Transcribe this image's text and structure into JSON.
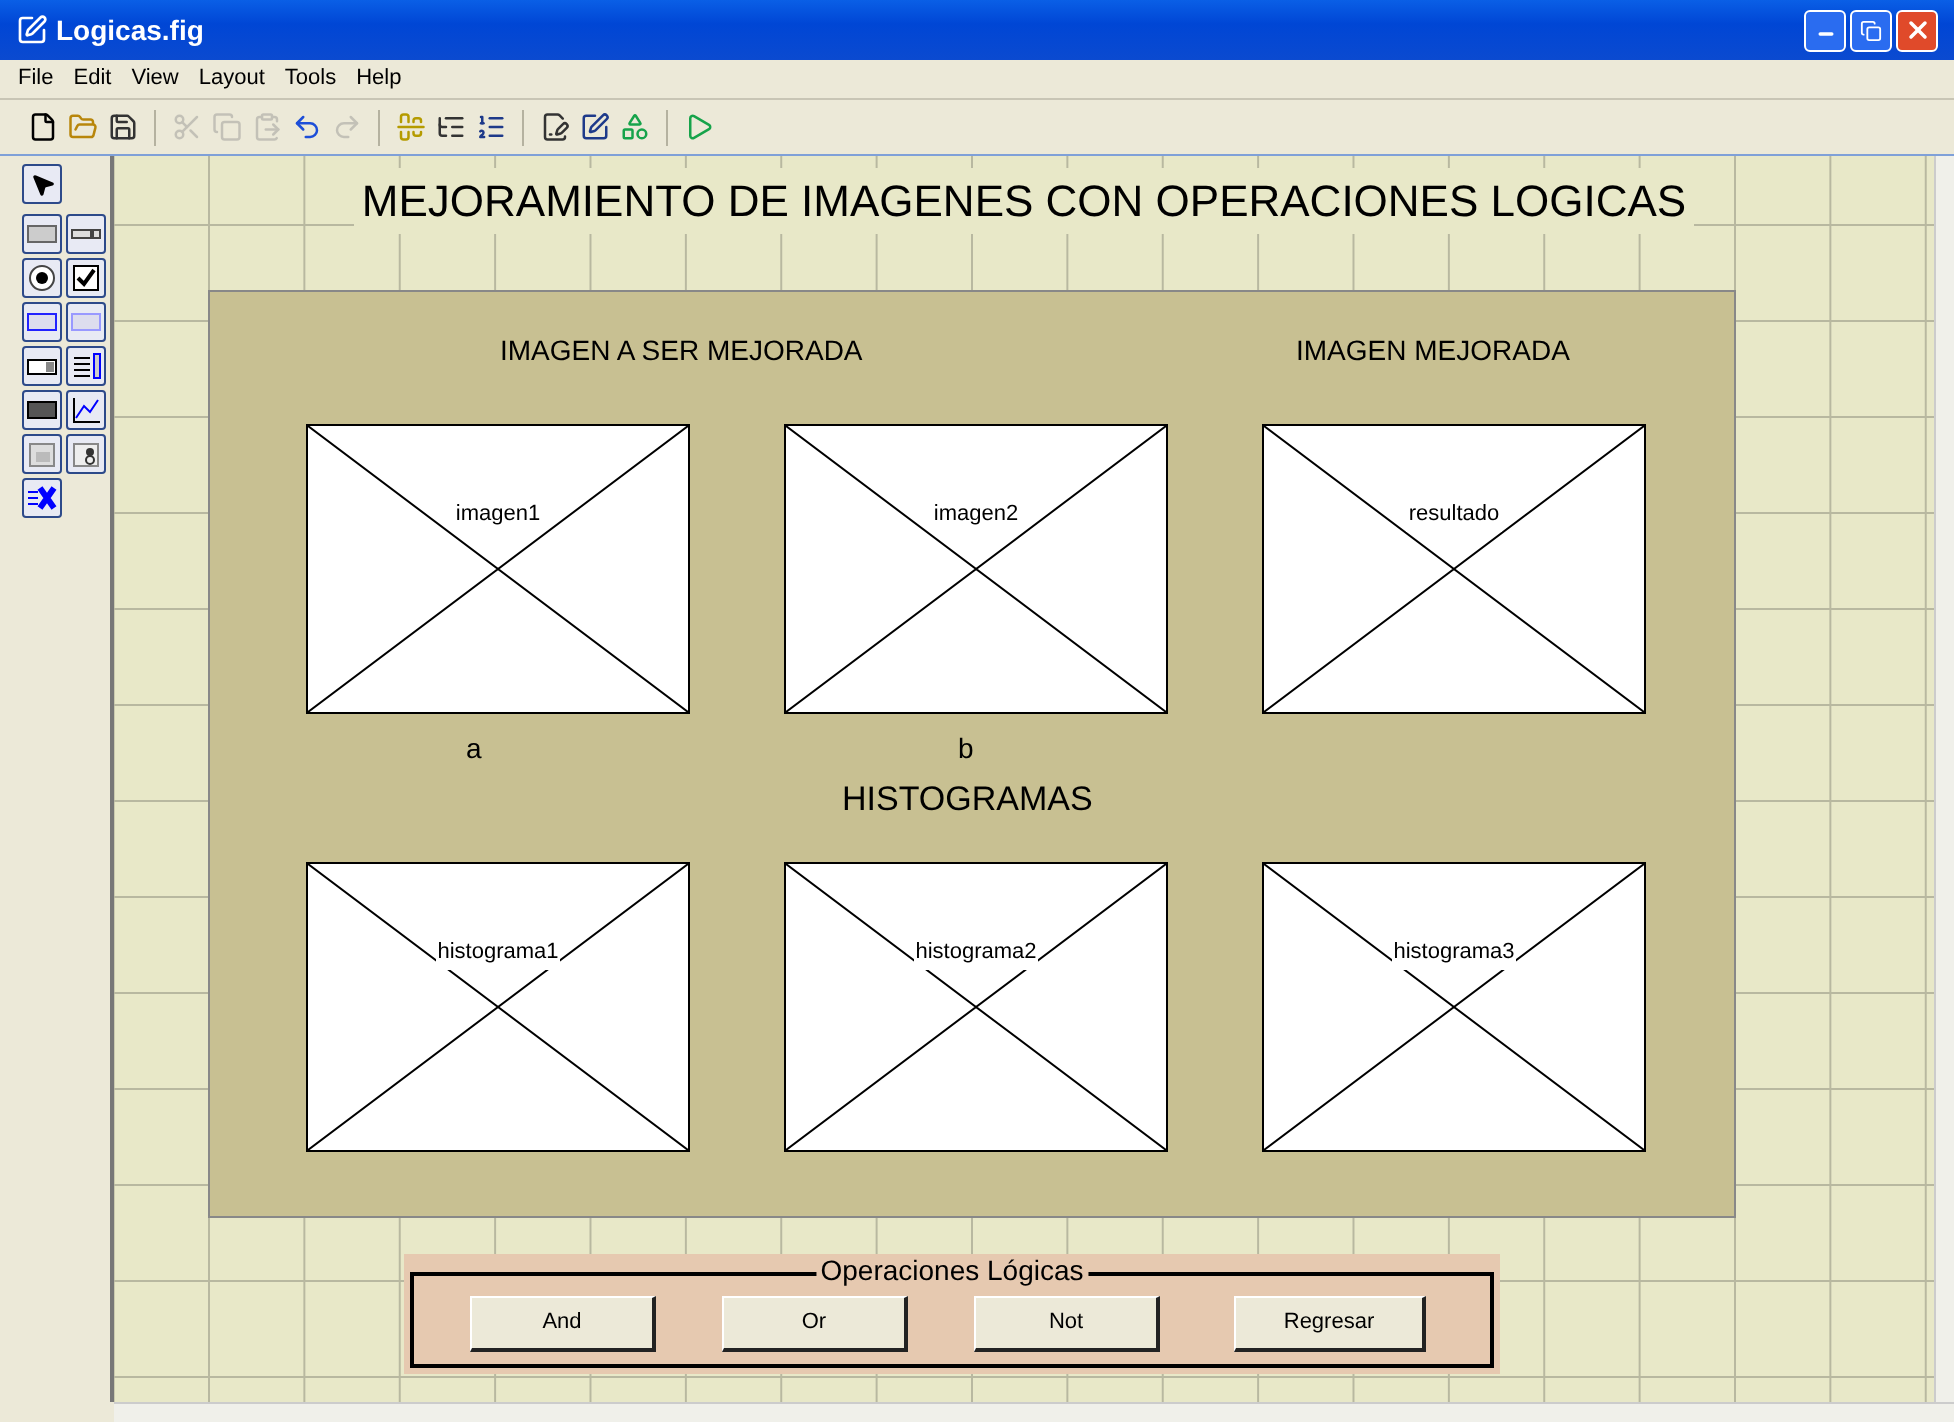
{
  "window": {
    "title": "Logicas.fig"
  },
  "menu": [
    "File",
    "Edit",
    "View",
    "Layout",
    "Tools",
    "Help"
  ],
  "toolbar": [
    {
      "kind": "new",
      "disabled": false
    },
    {
      "kind": "open",
      "disabled": false
    },
    {
      "kind": "save",
      "disabled": false
    },
    {
      "kind": "cut",
      "disabled": true
    },
    {
      "kind": "copy",
      "disabled": true
    },
    {
      "kind": "paste",
      "disabled": true
    },
    {
      "kind": "undo",
      "disabled": false
    },
    {
      "kind": "redo",
      "disabled": true
    },
    {
      "kind": "align",
      "disabled": false
    },
    {
      "kind": "menu",
      "disabled": false
    },
    {
      "kind": "taborder",
      "disabled": false
    },
    {
      "kind": "editor",
      "disabled": false
    },
    {
      "kind": "inspector",
      "disabled": false
    },
    {
      "kind": "browser",
      "disabled": false
    },
    {
      "kind": "run",
      "disabled": false
    }
  ],
  "figure": {
    "title": "MEJORAMIENTO DE IMAGENES CON OPERACIONES LOGICAS",
    "panel": {
      "labels": [
        "IMAGEN A SER MEJORADA",
        "IMAGEN MEJORADA"
      ],
      "axes": [
        {
          "tag": "imagen1"
        },
        {
          "tag": "imagen2"
        },
        {
          "tag": "resultado"
        },
        {
          "tag": "histograma1"
        },
        {
          "tag": "histograma2"
        },
        {
          "tag": "histograma3"
        }
      ],
      "captions": [
        "a",
        "b"
      ],
      "heading": "HISTOGRAMAS"
    },
    "button_group": {
      "title": "Operaciones Lógicas",
      "buttons": [
        "And",
        "Or",
        "Not",
        "Regresar"
      ]
    }
  }
}
